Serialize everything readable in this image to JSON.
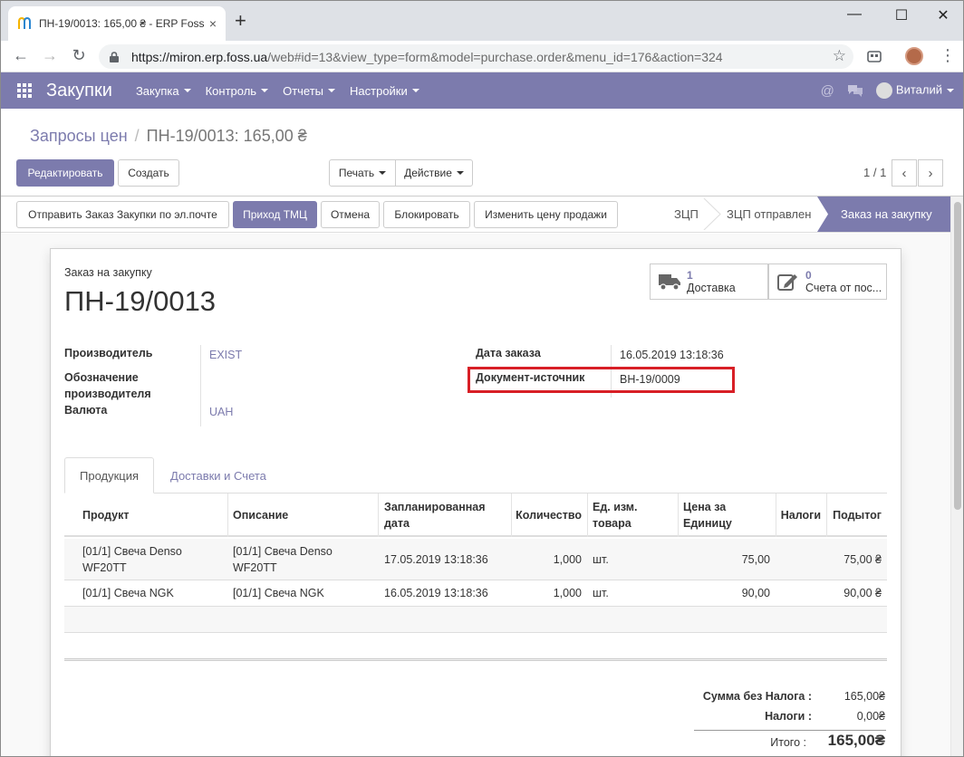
{
  "browser": {
    "tab_title": "ПН-19/0013: 165,00 ₴ - ERP Foss",
    "tab_close": "×",
    "new_tab": "+",
    "url_host": "https://miron.erp.foss.ua",
    "url_path": "/web#id=13&view_type=form&model=purchase.order&menu_id=176&action=324",
    "min": "—",
    "max": "☐",
    "close": "✕"
  },
  "navbar": {
    "app_name": "Закупки",
    "menus": [
      "Закупка",
      "Контроль",
      "Отчеты",
      "Настройки"
    ],
    "user": "Виталий"
  },
  "control_panel": {
    "breadcrumb_parent": "Запросы цен",
    "breadcrumb_current": "ПН-19/0013: 165,00 ₴",
    "edit_label": "Редактировать",
    "create_label": "Создать",
    "print_label": "Печать",
    "action_label": "Действие",
    "pager": "1 / 1"
  },
  "statusbar": {
    "buttons": [
      "Отправить Заказ Закупки по эл.почте",
      "Приход ТМЦ",
      "Отмена",
      "Блокировать",
      "Изменить цену продажи"
    ],
    "stages": [
      "ЗЦП",
      "ЗЦП отправлен",
      "Заказ на закупку"
    ],
    "active_stage": "Заказ на закупку"
  },
  "form": {
    "doc_type": "Заказ на закупку",
    "doc_name": "ПН-19/0013",
    "smart_buttons": [
      {
        "count": "1",
        "label": "Доставка",
        "icon": "truck-icon"
      },
      {
        "count": "0",
        "label": "Счета от пос...",
        "icon": "pencil-square-icon"
      }
    ],
    "fields_left": [
      {
        "label": "Производитель",
        "value": "EXIST"
      },
      {
        "label": "Обозначение производителя",
        "value": ""
      },
      {
        "label": "Валюта",
        "value": "UAH"
      }
    ],
    "fields_right": [
      {
        "label": "Дата заказа",
        "value": "16.05.2019 13:18:36"
      },
      {
        "label": "Документ-источник",
        "value": "ВН-19/0009"
      }
    ],
    "tabs": [
      "Продукция",
      "Доставки и Счета"
    ],
    "active_tab": "Продукция",
    "columns": [
      "Продукт",
      "Описание",
      "Запланированная дата",
      "Количество",
      "Ед. изм. товара",
      "Цена за Единицу",
      "Налоги",
      "Подытог"
    ],
    "lines": [
      {
        "product": "[01/1] Свеча Denso WF20TT",
        "description": "[01/1] Свеча Denso WF20TT",
        "date": "17.05.2019 13:18:36",
        "qty": "1,000",
        "uom": "шт.",
        "price": "75,00",
        "taxes": "",
        "subtotal": "75,00 ₴"
      },
      {
        "product": "[01/1] Свеча NGK",
        "description": "[01/1] Свеча NGK",
        "date": "16.05.2019 13:18:36",
        "qty": "1,000",
        "uom": "шт.",
        "price": "90,00",
        "taxes": "",
        "subtotal": "90,00 ₴"
      }
    ],
    "totals": {
      "untaxed_label": "Сумма без Налога :",
      "untaxed_value": "165,00₴",
      "taxes_label": "Налоги :",
      "taxes_value": "0,00₴",
      "total_label": "Итого :",
      "total_value": "165,00₴"
    }
  },
  "colors": {
    "accent": "#7c7bad",
    "highlight": "#d81f26"
  }
}
